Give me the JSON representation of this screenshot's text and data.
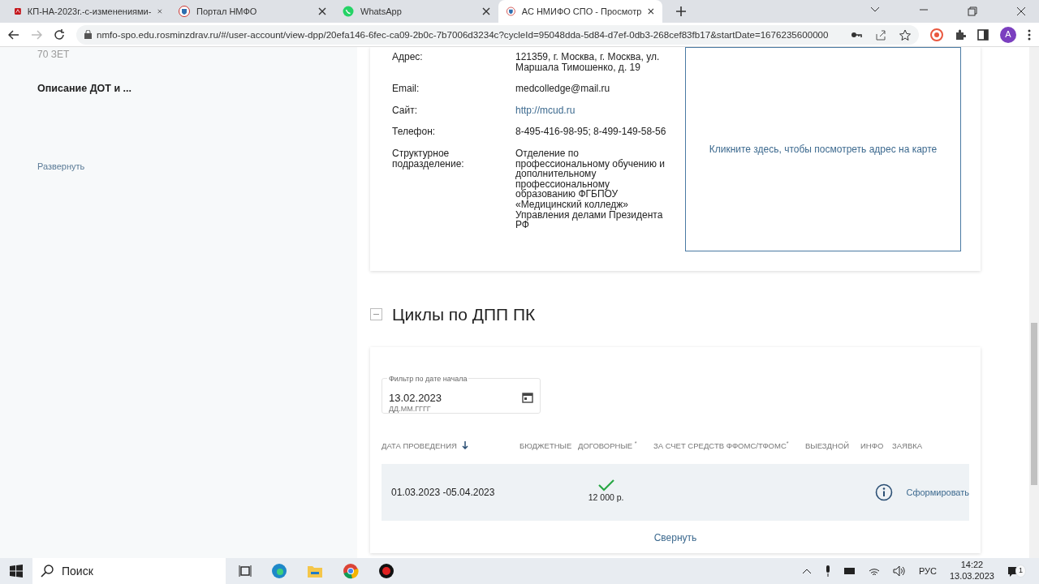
{
  "browser": {
    "tabs": [
      {
        "title": "КП-НА-2023г.-с-изменениями-",
        "kind": "pdf",
        "selected": false
      },
      {
        "title": "Портал НМФО",
        "kind": "portal",
        "selected": false
      },
      {
        "title": "WhatsApp",
        "kind": "whatsapp",
        "selected": false
      },
      {
        "title": "АС НМИФО СПО - Просмотр",
        "kind": "portal",
        "selected": true
      }
    ],
    "url": "nmfo-spo.edu.rosminzdrav.ru/#/user-account/view-dpp/20efa146-6fec-ca09-2b0c-7b7006d3234c?cycleId=95048dda-5d84-d7ef-0db3-268cef83fb17&startDate=1676235600000",
    "profile": "A"
  },
  "sidebar": {
    "hours": "70 ЗЕТ",
    "heading": "Описание ДОТ и ...",
    "expand_link": "Развернуть"
  },
  "contacts": [
    {
      "label": "Адрес:",
      "value": "121359, г. Москва, г. Москва, ул. Маршала Тимошенко, д. 19",
      "kind": "text"
    },
    {
      "label": "Email:",
      "value": "medcolledge@mail.ru",
      "kind": "text"
    },
    {
      "label": "Сайт:",
      "value": "http://mcud.ru",
      "kind": "link"
    },
    {
      "label": "Телефон:",
      "value": "8-495-416-98-95; 8-499-149-58-56",
      "kind": "text"
    },
    {
      "label": "Структурное подразделение:",
      "value": "Отделение по профессиональному обучению и дополнительному профессиональному образованию ФГБПОУ «Медицинский колледж» Управления делами Президента РФ",
      "kind": "text"
    }
  ],
  "map_link": "Кликните здесь, чтобы посмотреть адрес на карте",
  "cycles": {
    "title": "Циклы по ДПП ПК",
    "expanded": true,
    "filter": {
      "label": "Фильтр по дате начала",
      "value": "13.02.2023",
      "hint": "ДД.ММ.ГГГГ"
    },
    "columns": [
      {
        "label": "ДАТА ПРОВЕДЕНИЯ",
        "sorted": true
      },
      {
        "label": "БЮДЖЕТНЫЕ",
        "sorted": false
      },
      {
        "label": "ДОГОВОРНЫЕ $^{*}$",
        "sorted": false
      },
      {
        "label": "ЗА СЧЕТ СРЕДСТВ ФФОМС/ТФОМС$^{*}$",
        "sorted": false
      },
      {
        "label": "ВЫЕЗДНОЙ",
        "sorted": false
      },
      {
        "label": "ИНФО",
        "sorted": false
      },
      {
        "label": "ЗАЯВКА",
        "sorted": false
      }
    ],
    "rows": [
      {
        "dates": "01.03.2023 -05.04.2023",
        "budget_available": false,
        "contract_available": true,
        "contract_price": "12 000 р.",
        "action": "Сформировать"
      }
    ],
    "collapse_link": "Свернуть"
  },
  "taskbar": {
    "search": "Поиск",
    "language": "РУС",
    "time": "14:22",
    "date": "13.03.2023",
    "notifications": "1"
  }
}
